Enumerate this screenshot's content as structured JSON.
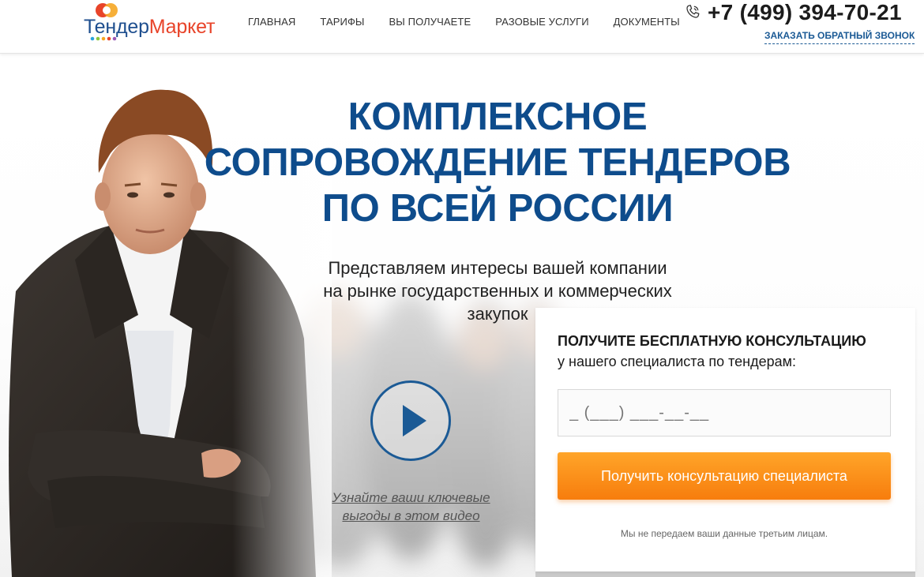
{
  "header": {
    "logo": {
      "part1": "Тендер",
      "part2": "Маркет"
    },
    "nav": [
      "ГЛАВНАЯ",
      "ТАРИФЫ",
      "ВЫ ПОЛУЧАЕТЕ",
      "РАЗОВЫЕ УСЛУГИ",
      "ДОКУМЕНТЫ"
    ],
    "phone": "+7 (499) 394-70-21",
    "callback_label": "ЗАКАЗАТЬ ОБРАТНЫЙ ЗВОНОК"
  },
  "hero": {
    "title_lines": [
      "КОМПЛЕКСНОЕ",
      "СОПРОВОЖДЕНИЕ ТЕНДЕРОВ",
      "ПО ВСЕЙ РОССИИ"
    ],
    "subtitle_lines": [
      "Представляем интересы вашей компании",
      "на рынке государственных и коммерческих",
      "закупок"
    ],
    "video_link_lines": [
      "Узнайте ваши ключевые",
      "выгоды в этом видео"
    ]
  },
  "form": {
    "title": "ПОЛУЧИТЕ БЕСПЛАТНУЮ КОНСУЛЬТАЦИЮ",
    "subtitle": "у нашего специалиста по тендерам:",
    "phone_placeholder": "_ (___) ___-__-__",
    "submit_label": "Получить консультацию специалиста",
    "privacy": "Мы не передаем ваши данные третьим лицам."
  },
  "colors": {
    "brand_blue": "#0e4c8c",
    "link_blue": "#1b5a95",
    "logo_red": "#e8442a",
    "button_orange": "#f98d18"
  },
  "icons": [
    "logo-icon",
    "phone-icon",
    "play-icon"
  ]
}
